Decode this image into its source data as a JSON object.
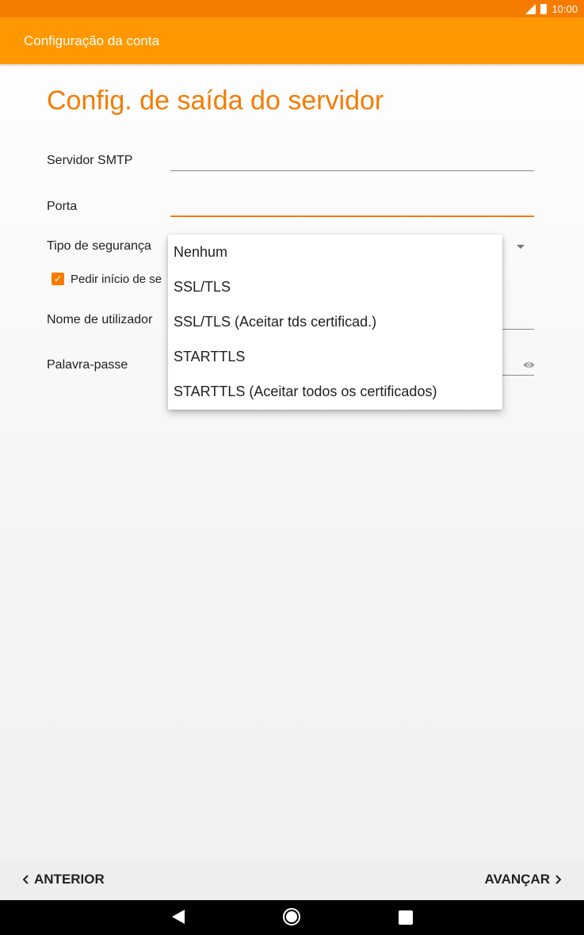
{
  "status_bar": {
    "time": "10:00"
  },
  "app_bar": {
    "title": "Configuração da conta"
  },
  "page": {
    "title": "Config. de saída do servidor"
  },
  "form": {
    "smtp_label": "Servidor SMTP",
    "port_label": "Porta",
    "security_label": "Tipo de segurança",
    "signin_checkbox_label": "Pedir início de se",
    "signin_checked": true,
    "username_label": "Nome de utilizador",
    "password_label": "Palavra-passe"
  },
  "dropdown": {
    "options": [
      "Nenhum",
      "SSL/TLS",
      "SSL/TLS (Aceitar tds certificad.)",
      "STARTTLS",
      "STARTTLS (Aceitar todos os certificados)"
    ]
  },
  "footer": {
    "back_label": "ANTERIOR",
    "next_label": "AVANÇAR"
  },
  "colors": {
    "accent": "#ff9800",
    "accent_dark": "#f57c00"
  },
  "icons": {
    "back": "chevron-left-icon",
    "next": "chevron-right-icon",
    "password_toggle": "eye-icon"
  }
}
